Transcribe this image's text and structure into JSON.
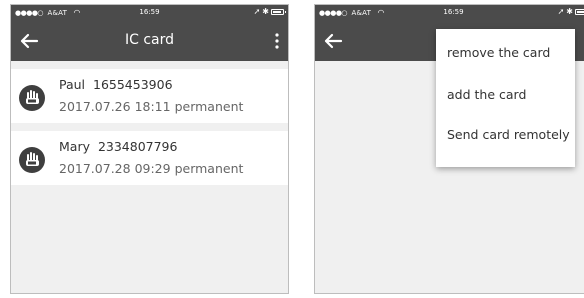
{
  "statusbar": {
    "carrier": "A&AT",
    "time": "16:59"
  },
  "left": {
    "title": "IC card",
    "cards": [
      {
        "name": "Paul",
        "number": "1655453906",
        "date": "2017.07.26",
        "time": "18:11",
        "type": "permanent"
      },
      {
        "name": "Mary",
        "number": "2334807796",
        "date": "2017.07.28",
        "time": "09:29",
        "type": "permanent"
      }
    ]
  },
  "right": {
    "menu": {
      "items": [
        "remove the card",
        "add the card",
        "Send card remotely"
      ]
    }
  },
  "icons": {
    "back": "arrow-left-icon",
    "more": "vertical-dots-icon",
    "card_avatar": "ic-card-hand-icon",
    "wifi": "wifi-icon",
    "bluetooth": "bluetooth-icon",
    "location": "location-arrow-icon",
    "battery": "battery-icon"
  },
  "colors": {
    "bar": "#4b4b4b",
    "background": "#f0f0f0",
    "card": "#ffffff"
  }
}
